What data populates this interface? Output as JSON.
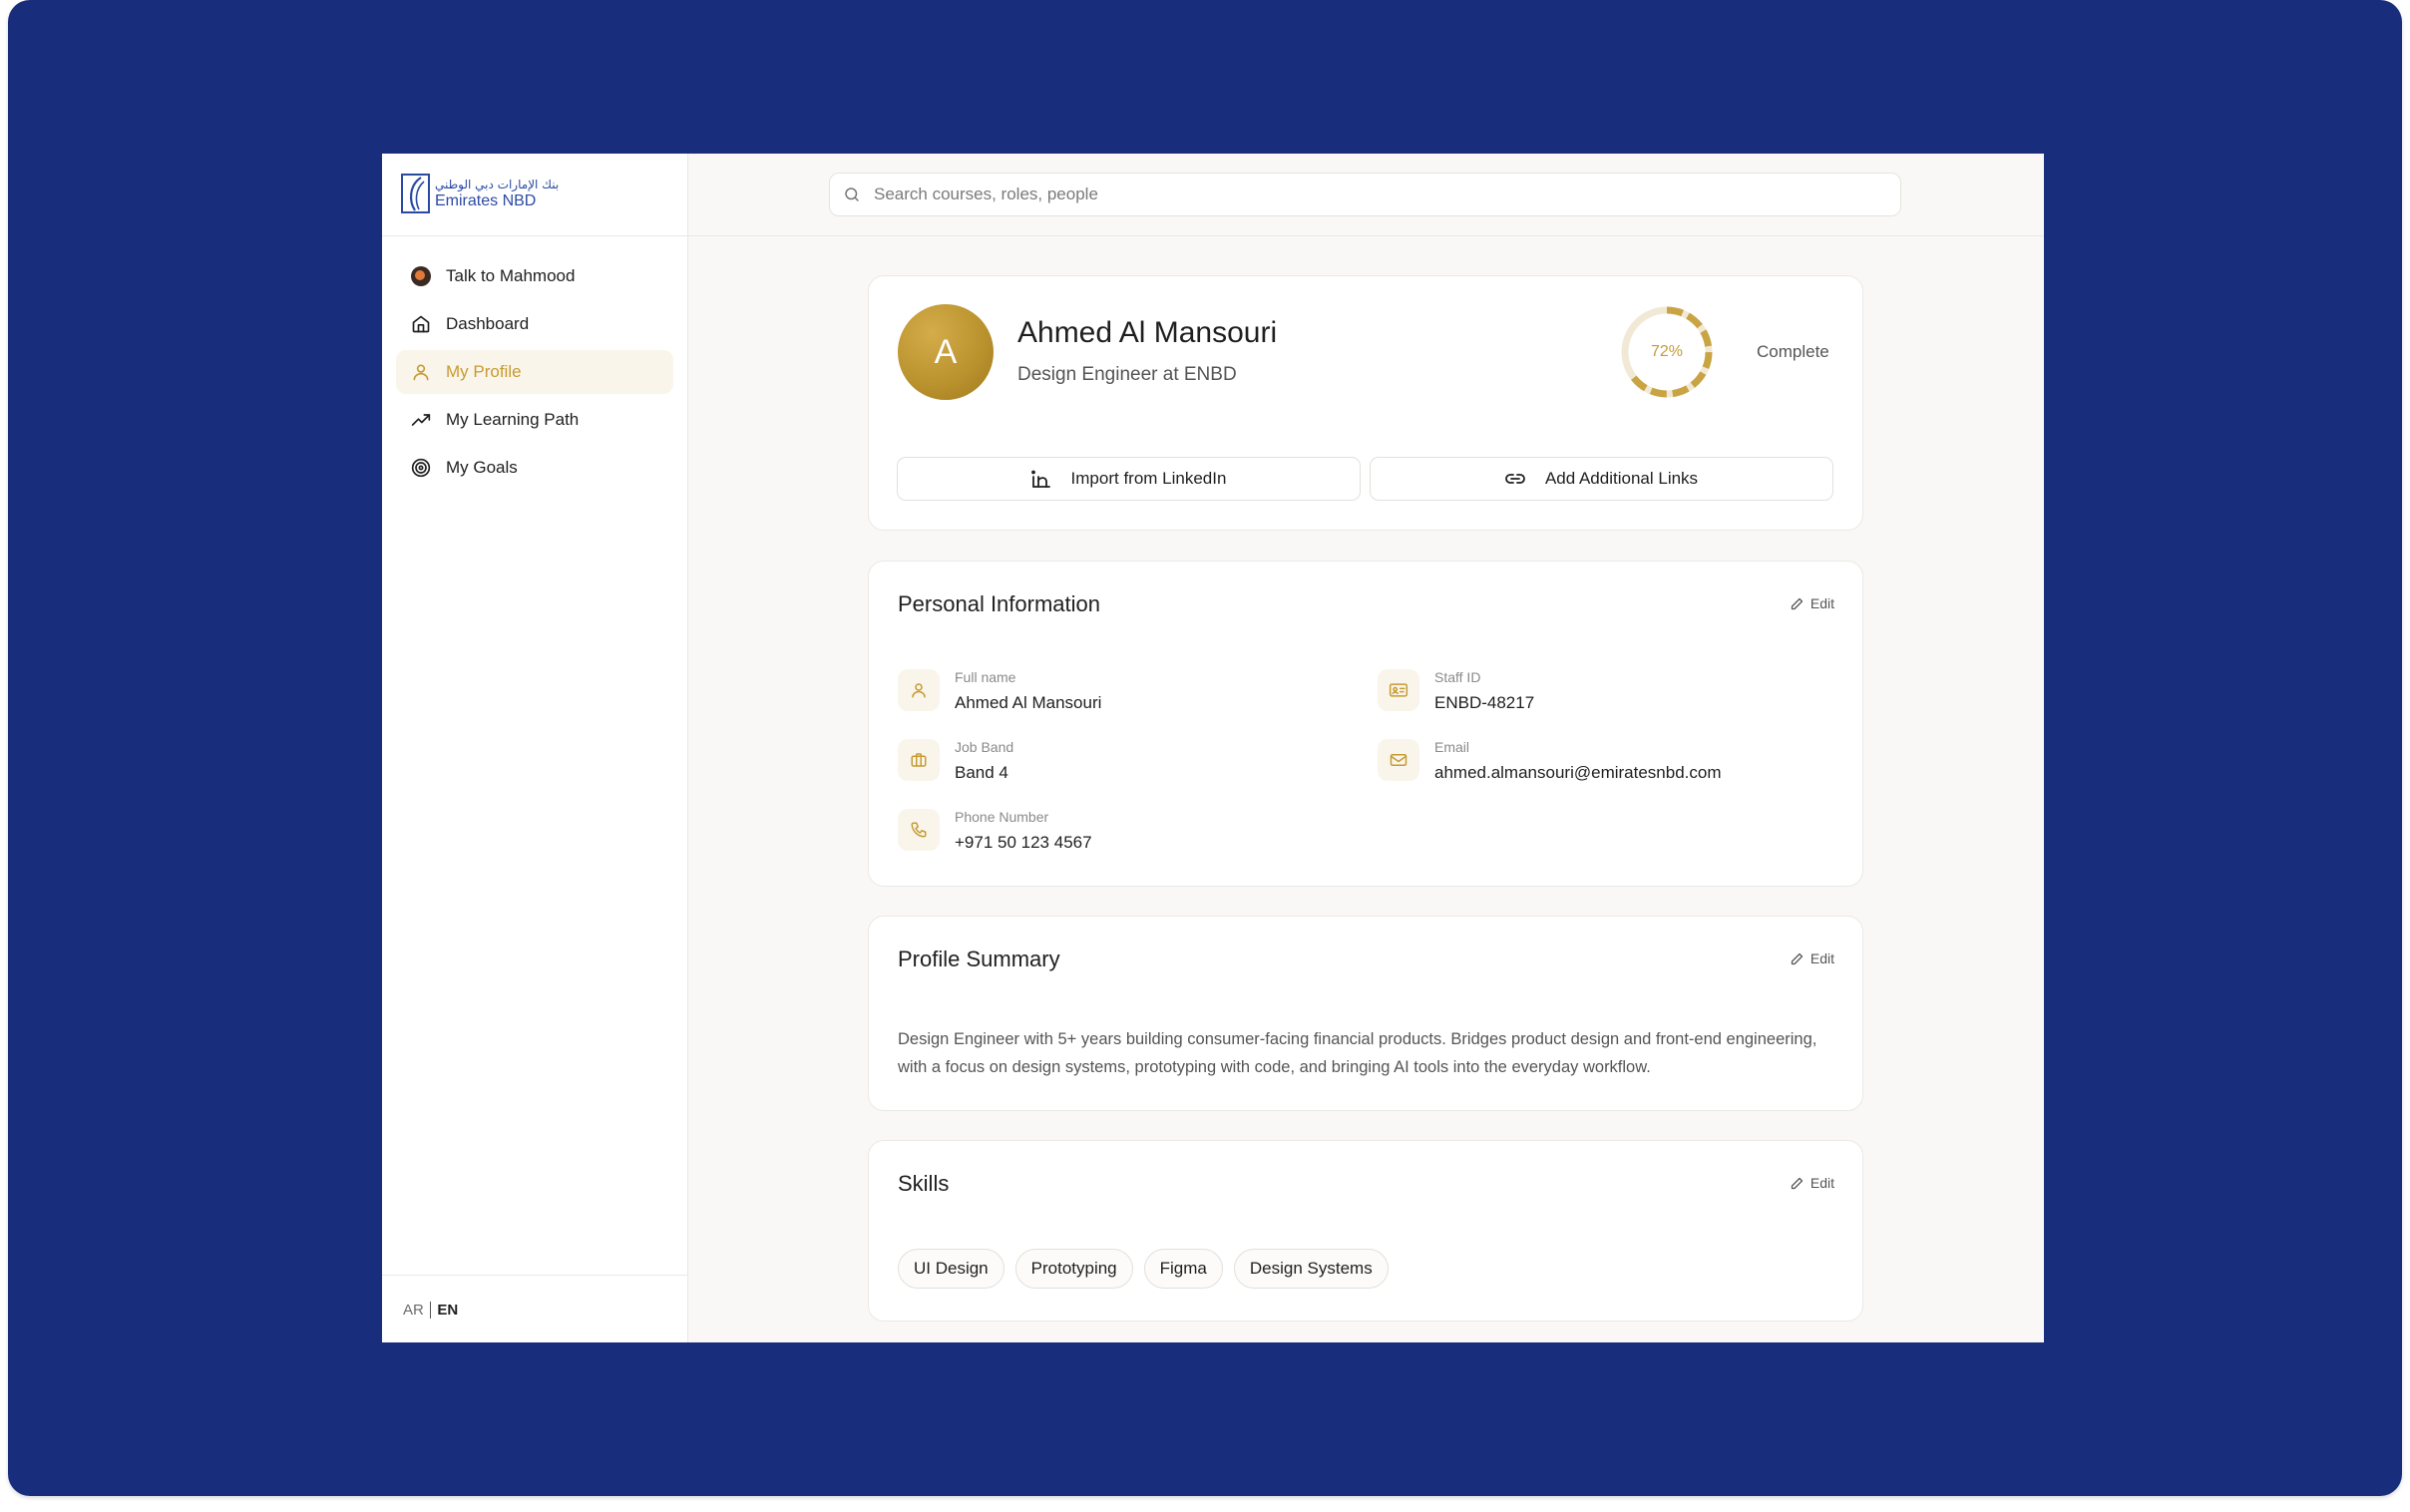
{
  "brand": {
    "name_ar": "بنك الإمارات دبي الوطني",
    "name_en": "Emirates NBD",
    "accent_color": "#c69b34",
    "frame_color": "#182e7c"
  },
  "sidebar": {
    "items": [
      {
        "label": "Talk to Mahmood",
        "icon": "mahmood-avatar-icon",
        "active": false
      },
      {
        "label": "Dashboard",
        "icon": "home-icon",
        "active": false
      },
      {
        "label": "My Profile",
        "icon": "user-icon",
        "active": true
      },
      {
        "label": "My Learning Path",
        "icon": "trending-up-icon",
        "active": false
      },
      {
        "label": "My Goals",
        "icon": "target-icon",
        "active": false
      }
    ],
    "lang_ar": "AR",
    "lang_en": "EN"
  },
  "search": {
    "placeholder": "Search courses, roles, people",
    "value": ""
  },
  "profile": {
    "initial": "A",
    "name": "Ahmed Al Mansouri",
    "role": "Design Engineer at ENBD",
    "completion_percent": 72,
    "completion_text": "72%",
    "completion_label": "Complete",
    "import_label": "Import from LinkedIn",
    "links_label": "Add Additional Links"
  },
  "personal_info": {
    "title": "Personal Information",
    "edit_label": "Edit",
    "full_name_label": "Full name",
    "full_name": "Ahmed Al Mansouri",
    "staff_id_label": "Staff ID",
    "staff_id": "ENBD-48217",
    "job_band_label": "Job Band",
    "job_band": "Band 4",
    "email_label": "Email",
    "email": "ahmed.almansouri@emiratesnbd.com",
    "phone_label": "Phone Number",
    "phone": "+971 50 123 4567"
  },
  "summary": {
    "title": "Profile Summary",
    "edit_label": "Edit",
    "text": "Design Engineer with 5+ years building consumer-facing financial products. Bridges product design and front-end engineering, with a focus on design systems, prototyping with code, and bringing AI tools into the everyday workflow."
  },
  "skills": {
    "title": "Skills",
    "edit_label": "Edit",
    "items": [
      "UI Design",
      "Prototyping",
      "Figma",
      "Design Systems"
    ]
  }
}
